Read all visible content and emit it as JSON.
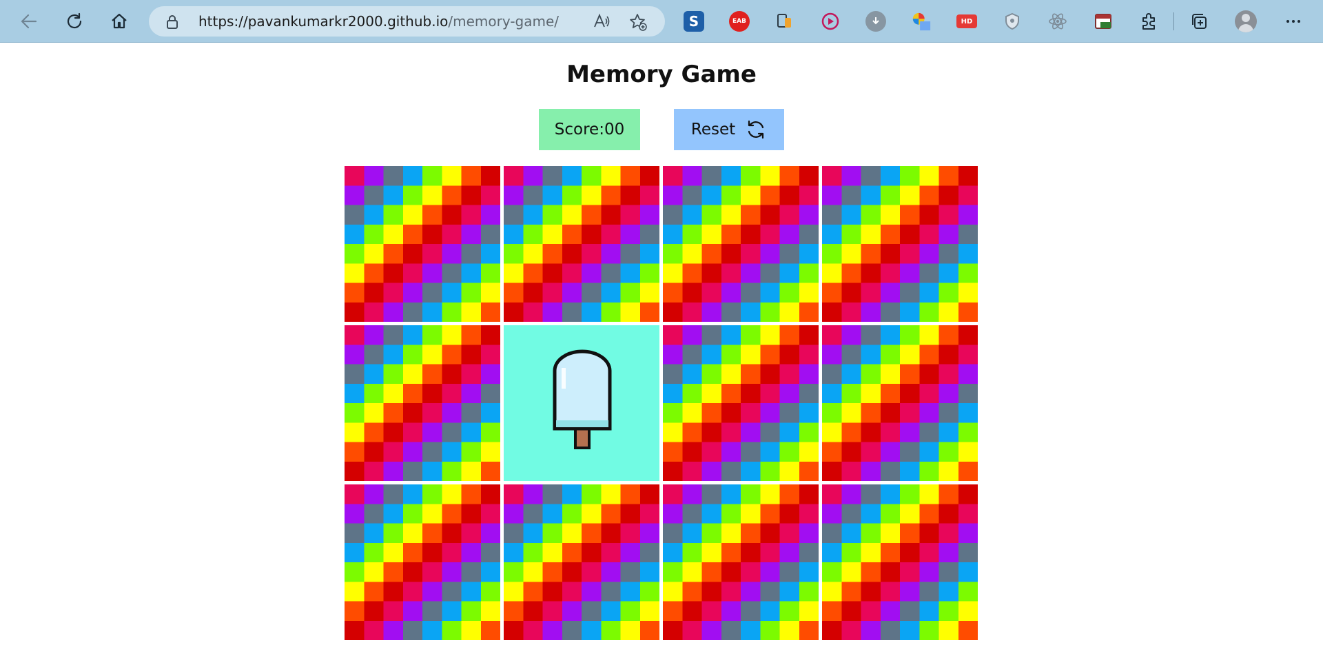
{
  "browser": {
    "url_host": "https://pavankumarkr2000.github.io",
    "url_path": "/memory-game/",
    "extensions": [
      {
        "name": "s-extension",
        "label": "S",
        "color": "#1e5fa8"
      },
      {
        "name": "eab-extension",
        "label": "EAB",
        "color": "#e0201e"
      },
      {
        "name": "window-extension",
        "label": "",
        "color": "#3d4a55"
      },
      {
        "name": "video-extension",
        "label": "",
        "color": "#c2185b"
      },
      {
        "name": "download-extension",
        "label": "",
        "color": "#7b8a96"
      },
      {
        "name": "color-extension",
        "label": "",
        "color": "#4a8fd8"
      },
      {
        "name": "hd-extension",
        "label": "HD",
        "color": "#e53935"
      },
      {
        "name": "shield-extension",
        "label": "",
        "color": "#8e9aa6"
      },
      {
        "name": "react-extension",
        "label": "",
        "color": "#8a97a3"
      },
      {
        "name": "calendar-extension",
        "label": "",
        "color": "#2e7d32"
      }
    ]
  },
  "page": {
    "title": "Memory Game",
    "score_label": "Score:00",
    "reset_label": "Reset"
  },
  "game": {
    "rows": 3,
    "cols": 4,
    "revealed_index": 5,
    "revealed_item": "popsicle",
    "card_back_palette": [
      "#e8065a",
      "#a10ef2",
      "#5e7488",
      "#0aa5f4",
      "#7cfb00",
      "#ffff00",
      "#ff4c00",
      "#d40000"
    ],
    "revealed_background": "#71fbe3"
  }
}
